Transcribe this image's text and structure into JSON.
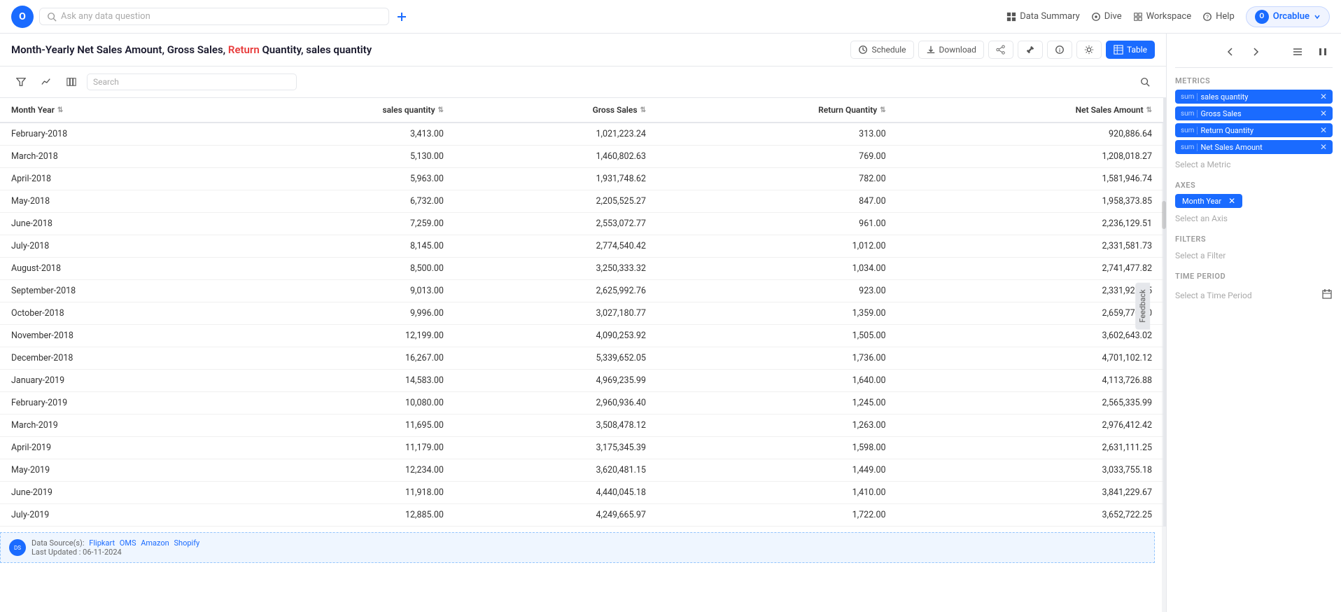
{
  "nav": {
    "logo_text": "O",
    "search_placeholder": "Ask any data question",
    "items": [
      {
        "id": "data-summary",
        "label": "Data Summary",
        "icon": "grid-icon"
      },
      {
        "id": "dive",
        "label": "Dive",
        "icon": "dive-icon"
      },
      {
        "id": "workspace",
        "label": "Workspace",
        "icon": "workspace-icon"
      },
      {
        "id": "help",
        "label": "Help",
        "icon": "help-icon"
      }
    ],
    "user": {
      "name": "Orcablue",
      "dot": "O"
    }
  },
  "page_title": "Month-Yearly Net Sales Amount, Gross Sales, Return Quantity, sales quantity",
  "toolbar": {
    "schedule_label": "Schedule",
    "download_label": "Download",
    "table_label": "Table"
  },
  "table": {
    "columns": [
      {
        "id": "month_year",
        "label": "Month Year"
      },
      {
        "id": "sales_quantity",
        "label": "sales quantity"
      },
      {
        "id": "gross_sales",
        "label": "Gross Sales"
      },
      {
        "id": "return_quantity",
        "label": "Return Quantity"
      },
      {
        "id": "net_sales_amount",
        "label": "Net Sales Amount"
      }
    ],
    "rows": [
      {
        "month_year": "February-2018",
        "sales_quantity": "3,413.00",
        "gross_sales": "1,021,223.24",
        "return_quantity": "313.00",
        "net_sales_amount": "920,886.64"
      },
      {
        "month_year": "March-2018",
        "sales_quantity": "5,130.00",
        "gross_sales": "1,460,802.63",
        "return_quantity": "769.00",
        "net_sales_amount": "1,208,018.27"
      },
      {
        "month_year": "April-2018",
        "sales_quantity": "5,963.00",
        "gross_sales": "1,931,748.62",
        "return_quantity": "782.00",
        "net_sales_amount": "1,581,946.74"
      },
      {
        "month_year": "May-2018",
        "sales_quantity": "6,732.00",
        "gross_sales": "2,205,525.27",
        "return_quantity": "847.00",
        "net_sales_amount": "1,958,373.85"
      },
      {
        "month_year": "June-2018",
        "sales_quantity": "7,259.00",
        "gross_sales": "2,553,072.77",
        "return_quantity": "961.00",
        "net_sales_amount": "2,236,129.51"
      },
      {
        "month_year": "July-2018",
        "sales_quantity": "8,145.00",
        "gross_sales": "2,774,540.42",
        "return_quantity": "1,012.00",
        "net_sales_amount": "2,331,581.73"
      },
      {
        "month_year": "August-2018",
        "sales_quantity": "8,500.00",
        "gross_sales": "3,250,333.32",
        "return_quantity": "1,034.00",
        "net_sales_amount": "2,741,477.82"
      },
      {
        "month_year": "September-2018",
        "sales_quantity": "9,013.00",
        "gross_sales": "2,625,992.76",
        "return_quantity": "923.00",
        "net_sales_amount": "2,331,925.05"
      },
      {
        "month_year": "October-2018",
        "sales_quantity": "9,996.00",
        "gross_sales": "3,027,180.77",
        "return_quantity": "1,359.00",
        "net_sales_amount": "2,659,770.80"
      },
      {
        "month_year": "November-2018",
        "sales_quantity": "12,199.00",
        "gross_sales": "4,090,253.92",
        "return_quantity": "1,505.00",
        "net_sales_amount": "3,602,643.02"
      },
      {
        "month_year": "December-2018",
        "sales_quantity": "16,267.00",
        "gross_sales": "5,339,652.05",
        "return_quantity": "1,736.00",
        "net_sales_amount": "4,701,102.12"
      },
      {
        "month_year": "January-2019",
        "sales_quantity": "14,583.00",
        "gross_sales": "4,969,235.99",
        "return_quantity": "1,640.00",
        "net_sales_amount": "4,113,726.88"
      },
      {
        "month_year": "February-2019",
        "sales_quantity": "10,080.00",
        "gross_sales": "2,960,936.40",
        "return_quantity": "1,245.00",
        "net_sales_amount": "2,565,335.99"
      },
      {
        "month_year": "March-2019",
        "sales_quantity": "11,695.00",
        "gross_sales": "3,508,478.12",
        "return_quantity": "1,263.00",
        "net_sales_amount": "2,976,412.42"
      },
      {
        "month_year": "April-2019",
        "sales_quantity": "11,179.00",
        "gross_sales": "3,175,345.39",
        "return_quantity": "1,598.00",
        "net_sales_amount": "2,631,111.25"
      },
      {
        "month_year": "May-2019",
        "sales_quantity": "12,234.00",
        "gross_sales": "3,620,481.15",
        "return_quantity": "1,449.00",
        "net_sales_amount": "3,033,755.18"
      },
      {
        "month_year": "June-2019",
        "sales_quantity": "11,918.00",
        "gross_sales": "4,440,045.18",
        "return_quantity": "1,410.00",
        "net_sales_amount": "3,841,229.67"
      },
      {
        "month_year": "July-2019",
        "sales_quantity": "12,885.00",
        "gross_sales": "4,249,665.97",
        "return_quantity": "1,722.00",
        "net_sales_amount": "3,652,722.25"
      }
    ],
    "search_placeholder": "Search"
  },
  "sidebar": {
    "sections": {
      "metrics": {
        "label": "Metrics",
        "items": [
          {
            "id": "sales-quantity",
            "prefix": "sum",
            "name": "sales quantity"
          },
          {
            "id": "gross-sales",
            "prefix": "sum",
            "name": "Gross Sales"
          },
          {
            "id": "return-quantity",
            "prefix": "sum",
            "name": "Return Quantity"
          },
          {
            "id": "net-sales-amount",
            "prefix": "sum",
            "name": "Net Sales Amount"
          }
        ],
        "select_placeholder": "Select a Metric"
      },
      "axes": {
        "label": "Axes",
        "item": "Month Year",
        "select_placeholder": "Select an Axis"
      },
      "filters": {
        "label": "Filters",
        "select_placeholder": "Select a Filter"
      },
      "time_period": {
        "label": "Time Period",
        "select_placeholder": "Select a Time Period"
      }
    }
  },
  "footer": {
    "icon_text": "DS",
    "sources_label": "Data Source(s):",
    "sources": [
      "Flipkart",
      "OMS",
      "Amazon",
      "Shopify"
    ],
    "last_updated_label": "Last Updated : 06-11-2024"
  },
  "feedback_label": "Feedback"
}
